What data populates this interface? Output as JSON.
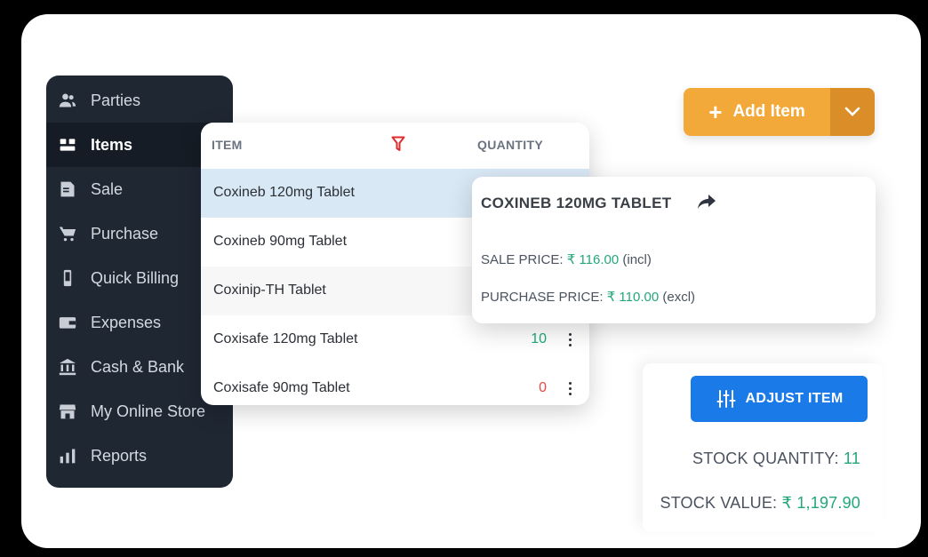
{
  "sidebar": {
    "items": [
      {
        "label": "Parties",
        "icon": "users-icon",
        "active": false
      },
      {
        "label": "Items",
        "icon": "items-icon",
        "active": true
      },
      {
        "label": "Sale",
        "icon": "sale-icon",
        "active": false
      },
      {
        "label": "Purchase",
        "icon": "cart-icon",
        "active": false
      },
      {
        "label": "Quick Billing",
        "icon": "mobile-icon",
        "active": false
      },
      {
        "label": "Expenses",
        "icon": "wallet-icon",
        "active": false
      },
      {
        "label": "Cash & Bank",
        "icon": "bank-icon",
        "active": false
      },
      {
        "label": "My Online Store",
        "icon": "store-icon",
        "active": false
      },
      {
        "label": "Reports",
        "icon": "bar-chart-icon",
        "active": false
      }
    ]
  },
  "table": {
    "col_item": "ITEM",
    "col_quantity": "QUANTITY",
    "rows": [
      {
        "name": "Coxineb 120mg Tablet",
        "qty": ""
      },
      {
        "name": "Coxineb 90mg Tablet",
        "qty": ""
      },
      {
        "name": "Coxinip-TH Tablet",
        "qty": ""
      },
      {
        "name": "Coxisafe 120mg Tablet",
        "qty": "10"
      },
      {
        "name": "Coxisafe 90mg Tablet",
        "qty": "0"
      }
    ]
  },
  "detail": {
    "title": "COXINEB 120MG TABLET",
    "sale_label": "SALE PRICE:",
    "sale_value": "₹ 116.00",
    "sale_suffix": "(incl)",
    "purchase_label": "PURCHASE PRICE:",
    "purchase_value": "₹ 110.00",
    "purchase_suffix": "(excl)"
  },
  "add_item": {
    "label": "Add Item"
  },
  "adjust_item": {
    "label": "ADJUST ITEM"
  },
  "stock": {
    "quantity_label": "STOCK QUANTITY:",
    "quantity_value": "11",
    "value_label": "STOCK VALUE:",
    "value_value": "₹ 1,197.90"
  },
  "colors": {
    "sidebar_bg": "#1f2733",
    "accent_orange": "#f3a93a",
    "accent_blue": "#1a7ae8",
    "positive_green": "#22a77a",
    "negative_red": "#e34949",
    "selected_row": "#d8e8f4"
  }
}
